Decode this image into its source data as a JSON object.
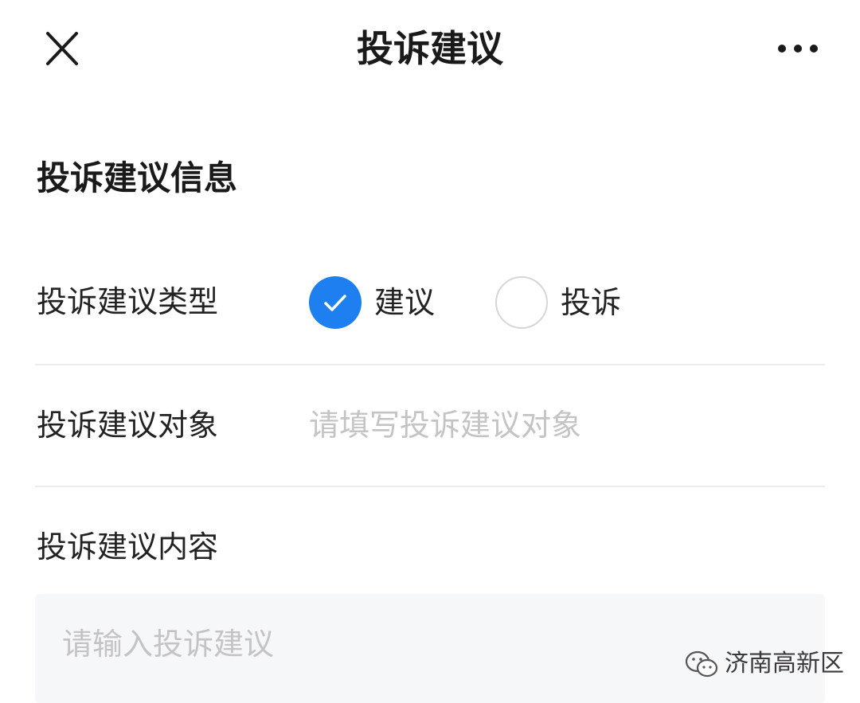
{
  "nav": {
    "title": "投诉建议",
    "close_icon": "close-icon",
    "more_icon": "more-dots-icon"
  },
  "section": {
    "title": "投诉建议信息"
  },
  "form": {
    "type": {
      "label": "投诉建议类型",
      "options": [
        {
          "label": "建议",
          "checked": true
        },
        {
          "label": "投诉",
          "checked": false
        }
      ]
    },
    "target": {
      "label": "投诉建议对象",
      "value": "",
      "placeholder": "请填写投诉建议对象"
    },
    "content": {
      "label": "投诉建议内容",
      "value": "",
      "placeholder": "请输入投诉建议"
    }
  },
  "watermark": {
    "text": "济南高新区",
    "icon": "wechat-official-account-icon"
  },
  "colors": {
    "accent": "#1e7ff0",
    "placeholder": "#c4c4c4",
    "divider": "#ececec",
    "textarea_bg": "#f6f7f9"
  }
}
